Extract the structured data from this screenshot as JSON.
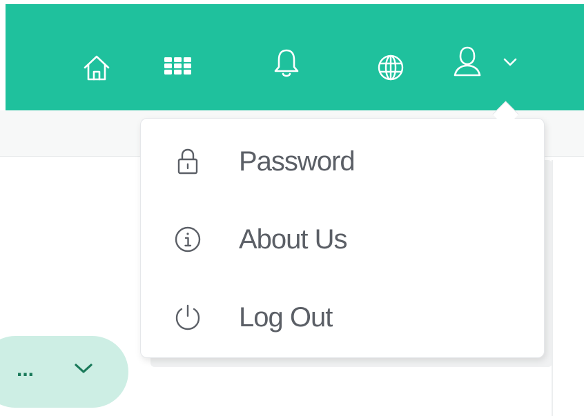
{
  "header": {
    "background_color": "#1fc19d",
    "icons": [
      "home-icon",
      "apps-grid-icon",
      "notification-bell-icon",
      "globe-icon",
      "user-icon",
      "chevron-down-icon"
    ]
  },
  "user_menu": {
    "items": [
      {
        "icon": "lock-icon",
        "label": "Password"
      },
      {
        "icon": "info-icon",
        "label": "About Us"
      },
      {
        "icon": "power-icon",
        "label": "Log Out"
      }
    ]
  },
  "select_pill": {
    "value": "...",
    "icon": "chevron-down-icon",
    "background_color": "#cdeee4"
  }
}
